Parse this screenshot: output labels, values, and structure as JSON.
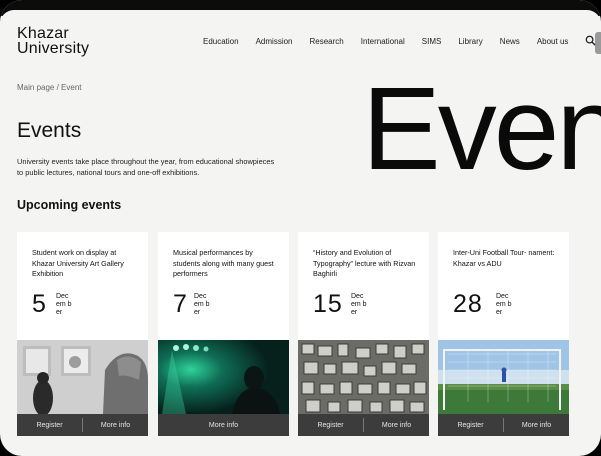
{
  "logo": {
    "line1": "Khazar",
    "line2": "University"
  },
  "nav": {
    "items": [
      "Education",
      "Admission",
      "Research",
      "International",
      "SIMS",
      "Library",
      "News",
      "About us"
    ]
  },
  "breadcrumb": "Main page / Event",
  "hero_word": "Even",
  "page_title": "Events",
  "intro": "University events take place throughout the year, from educational showpieces to public lectures, national tours and one-off exhibitions.",
  "section_title": "Upcoming events",
  "cards": [
    {
      "title": "Student work on display at Khazar University Art Gallery Exhibition",
      "day": "5",
      "month": "Dec em ber",
      "register": "Register",
      "more": "More info",
      "image": "gallery-photo"
    },
    {
      "title": "Musical performances by students along with many guest performers",
      "day": "7",
      "month": "Dec em ber",
      "more": "More info",
      "image": "concert-photo"
    },
    {
      "title": "“History and Evolution of Typography” lecture with Rizvan Baghirli",
      "day": "15",
      "month": "Dec em ber",
      "register": "Register",
      "more": "More info",
      "image": "typography-photo"
    },
    {
      "title": "Inter-Uni Football Tour- nament: Khazar vs ADU",
      "day": "28",
      "month": "Dec em ber",
      "register": "Register",
      "more": "More info",
      "image": "football-photo"
    }
  ]
}
